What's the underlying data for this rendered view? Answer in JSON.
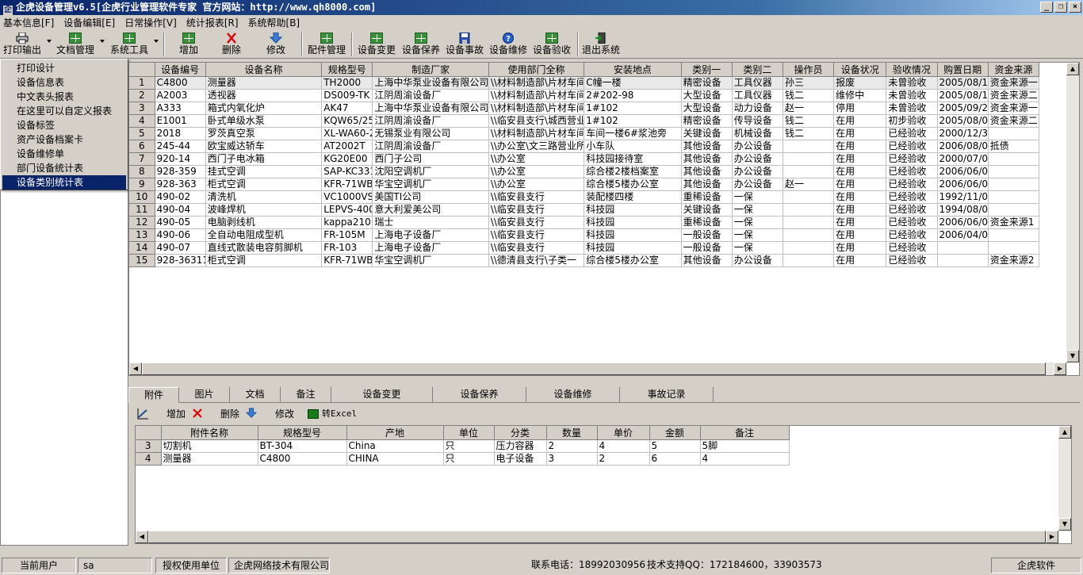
{
  "window": {
    "title": "企虎设备管理v6.5[企虎行业管理软件专家 官方网站：http://www.qh8000.com]"
  },
  "menu": [
    "基本信息[F]",
    "设备编辑[E]",
    "日常操作[V]",
    "统计报表[R]",
    "系统帮助[B]"
  ],
  "toolbar": {
    "print": "打印输出",
    "docs": "文档管理",
    "systools": "系统工具",
    "add": "增加",
    "delete": "删除",
    "edit": "修改",
    "parts": "配件管理",
    "change": "设备变更",
    "maintain": "设备保养",
    "accident": "设备事故",
    "repair": "设备维修",
    "accept": "设备验收",
    "exit": "退出系统"
  },
  "print_menu": [
    "打印设计",
    "设备信息表",
    "中文表头报表",
    "在这里可以自定义报表",
    "设备标签",
    "资产设备档案卡",
    "设备维修单",
    "部门设备统计表",
    "设备类别统计表"
  ],
  "grid": {
    "columns": [
      "设备编号",
      "设备名称",
      "规格型号",
      "制造厂家",
      "使用部门全称",
      "安装地点",
      "类别一",
      "类别二",
      "操作员",
      "设备状况",
      "验收情况",
      "购置日期",
      "资金来源"
    ],
    "rows": [
      [
        "1",
        "C4800",
        "测量器",
        "TH2000",
        "上海中华泵业设备有限公司",
        "\\\\材料制造部\\片材车间",
        "C幢一楼",
        "精密设备",
        "工具仪器",
        "孙三",
        "报废",
        "未曾验收",
        "2005/08/13",
        "资金来源一"
      ],
      [
        "2",
        "A2003",
        "透视器",
        "DS009-TK",
        "江阴周渝设备厂",
        "\\\\材料制造部\\片材车间",
        "2#202-98",
        "大型设备",
        "工具仪器",
        "钱二",
        "维修中",
        "未曾验收",
        "2005/08/13",
        "资金来源二"
      ],
      [
        "3",
        "A333",
        "箱式内氧化炉",
        "AK47",
        "上海中华泵业设备有限公司",
        "\\\\材料制造部\\片材车间",
        "1#102",
        "大型设备",
        "动力设备",
        "赵一",
        "停用",
        "未曾验收",
        "2005/09/22",
        "资金来源一"
      ],
      [
        "4",
        "E1001",
        "卧式单级水泵",
        "KQW65/250",
        "江阴周渝设备厂",
        "\\\\临安县支行\\城西营业",
        "1#102",
        "精密设备",
        "传导设备",
        "钱二",
        "在用",
        "初步验收",
        "2005/08/09",
        "资金来源二"
      ],
      [
        "5",
        "2018",
        "罗茨真空泵",
        "XL-WA60-20",
        "无锡泵业有限公司",
        "\\\\材料制造部\\片材车间",
        "车间一楼6#浆池旁",
        "关键设备",
        "机械设备",
        "钱二",
        "在用",
        "已经验收",
        "2000/12/30",
        ""
      ],
      [
        "6",
        "245-44",
        "欧宝威达轿车",
        "AT2002T",
        "江阴周渝设备厂",
        "\\\\办公室\\文三路营业所",
        "小车队",
        "其他设备",
        "办公设备",
        "",
        "在用",
        "已经验收",
        "2006/08/02",
        "抵债"
      ],
      [
        "7",
        "920-14",
        "西门子电冰箱",
        "KG20E00",
        "西门子公司",
        "\\\\办公室",
        "科技园接待室",
        "其他设备",
        "办公设备",
        "",
        "在用",
        "已经验收",
        "2000/07/01",
        ""
      ],
      [
        "8",
        "928-359",
        "挂式空调",
        "SAP-KC331C",
        "沈阳空调机厂",
        "\\\\办公室",
        "综合楼2楼档案室",
        "其他设备",
        "办公设备",
        "",
        "在用",
        "已经验收",
        "2006/06/01",
        ""
      ],
      [
        "9",
        "928-363",
        "柜式空调",
        "KFR-71WB3S",
        "华宝空调机厂",
        "\\\\办公室",
        "综合楼5楼办公室",
        "其他设备",
        "办公设备",
        "赵一",
        "在用",
        "已经验收",
        "2006/06/01",
        ""
      ],
      [
        "10",
        "490-02",
        "清洗机",
        "VC1000VS",
        "美国TI公司",
        "\\\\临安县支行",
        "装配楼四楼",
        "重稀设备",
        "一保",
        "",
        "在用",
        "已经验收",
        "1992/11/01",
        ""
      ],
      [
        "11",
        "490-04",
        "波峰焊机",
        "LEPVS-400F",
        "意大利爱美公司",
        "\\\\临安县支行",
        "科技园",
        "关键设备",
        "一保",
        "",
        "在用",
        "已经验收",
        "1994/08/01",
        ""
      ],
      [
        "12",
        "490-05",
        "电脑剥线机",
        "kappa210",
        "瑞士",
        "\\\\临安县支行",
        "科技园",
        "重稀设备",
        "一保",
        "",
        "在用",
        "已经验收",
        "2006/06/01",
        "资金来源1"
      ],
      [
        "13",
        "490-06",
        "全自动电阻成型机",
        "FR-105M",
        "上海电子设备厂",
        "\\\\临安县支行",
        "科技园",
        "一般设备",
        "一保",
        "",
        "在用",
        "已经验收",
        "2006/04/02",
        ""
      ],
      [
        "14",
        "490-07",
        "直线式散装电容剪脚机",
        "FR-103",
        "上海电子设备厂",
        "\\\\临安县支行",
        "科技园",
        "一般设备",
        "一保",
        "",
        "在用",
        "已经验收",
        "",
        ""
      ],
      [
        "15",
        "928-3631112",
        "柜式空调",
        "KFR-71WB3S",
        "华宝空调机厂",
        "\\\\德清县支行\\子类一",
        "综合楼5楼办公室",
        "其他设备",
        "办公设备",
        "",
        "在用",
        "已经验收",
        "",
        "资金来源2"
      ]
    ]
  },
  "tabs": [
    "附件",
    "图片",
    "文档",
    "备注",
    "设备变更",
    "设备保养",
    "设备维修",
    "事故记录"
  ],
  "subtoolbar": {
    "add": "增加",
    "delete": "删除",
    "edit": "修改",
    "excel": "转Excel"
  },
  "subgrid": {
    "columns": [
      "附件名称",
      "规格型号",
      "产地",
      "单位",
      "分类",
      "数量",
      "单价",
      "金额",
      "备注"
    ],
    "rows": [
      [
        "3",
        "切割机",
        "BT-304",
        "China",
        "只",
        "压力容器",
        "2",
        "4",
        "5",
        "5脚"
      ],
      [
        "4",
        "测量器",
        "C4800",
        "CHINA",
        "只",
        "电子设备",
        "3",
        "2",
        "6",
        "4"
      ]
    ]
  },
  "status": {
    "user_label": "当前用户",
    "user": "sa",
    "license_label": "授权使用单位",
    "company": "企虎网络技术有限公司",
    "phone": "联系电话：18992030956",
    "qq": "技术支持QQ：172184600，33903573",
    "brand": "企虎软件"
  }
}
